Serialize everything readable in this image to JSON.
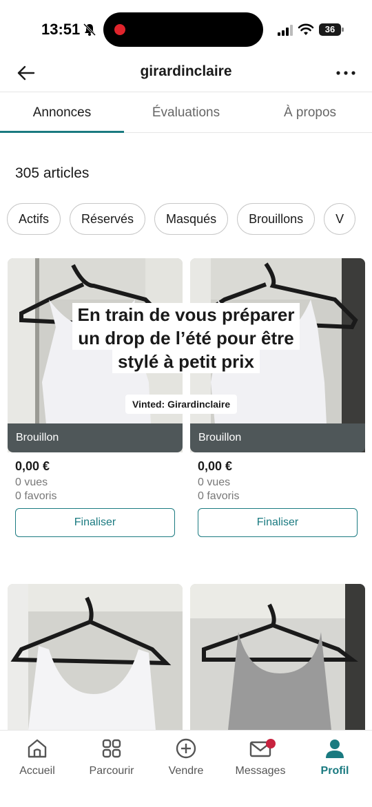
{
  "status_bar": {
    "time": "13:51",
    "battery": "36"
  },
  "header": {
    "title": "girardinclaire"
  },
  "tabs": [
    {
      "label": "Annonces",
      "active": true
    },
    {
      "label": "Évaluations",
      "active": false
    },
    {
      "label": "À propos",
      "active": false
    }
  ],
  "count": "305 articles",
  "filters": [
    "Actifs",
    "Réservés",
    "Masqués",
    "Brouillons",
    "V"
  ],
  "items": [
    {
      "status": "Brouillon",
      "price": "0,00 €",
      "views": "0 vues",
      "favorites": "0 favoris",
      "action": "Finaliser"
    },
    {
      "status": "Brouillon",
      "price": "0,00 €",
      "views": "0 vues",
      "favorites": "0 favoris",
      "action": "Finaliser"
    }
  ],
  "promo": {
    "line1": "En train de vous préparer",
    "line2": "un drop de l’été pour être",
    "line3": "stylé à petit prix",
    "tag": "Vinted: Girardinclaire"
  },
  "bottom_nav": [
    {
      "label": "Accueil",
      "icon": "home-icon"
    },
    {
      "label": "Parcourir",
      "icon": "grid-icon"
    },
    {
      "label": "Vendre",
      "icon": "plus-circle-icon"
    },
    {
      "label": "Messages",
      "icon": "mail-icon"
    },
    {
      "label": "Profil",
      "icon": "profile-icon",
      "active": true
    }
  ],
  "colors": {
    "accent": "#1a7a80",
    "draft_band": "#4f5759",
    "notification": "#c8233f"
  }
}
